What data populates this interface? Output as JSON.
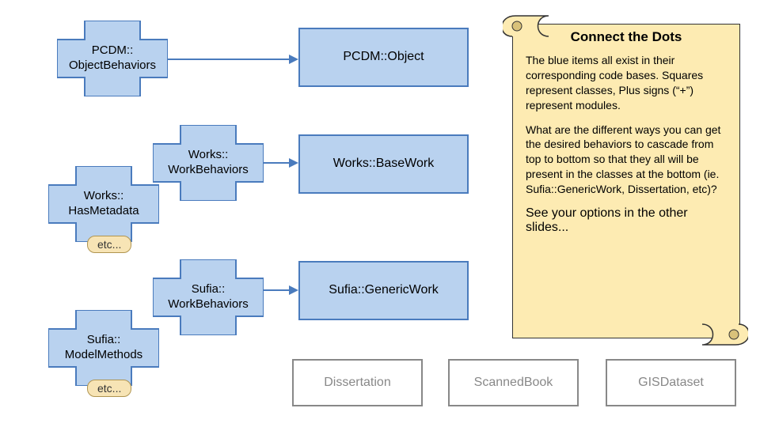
{
  "plus_shapes": {
    "pcdm_obj_beh": "PCDM::\nObjectBehaviors",
    "works_work_beh": "Works::\nWorkBehaviors",
    "works_has_meta": "Works::\nHasMetadata",
    "sufia_work_beh": "Sufia::\nWorkBehaviors",
    "sufia_model_meth": "Sufia::\nModelMethods"
  },
  "rects_blue": {
    "pcdm_object": "PCDM::Object",
    "works_basework": "Works::BaseWork",
    "sufia_genericwork": "Sufia::GenericWork"
  },
  "rects_white": {
    "dissertation": "Dissertation",
    "scannedbook": "ScannedBook",
    "gisdataset": "GISDataset"
  },
  "etc_labels": {
    "etc1": "etc...",
    "etc2": "etc..."
  },
  "scroll": {
    "title": "Connect the Dots",
    "p1": "The blue items all exist in their corresponding code bases.  Squares represent classes, Plus signs (“+”) represent modules.",
    "p2": "What are the different ways you can get the desired behaviors to cascade from top to bottom so that they all will be present in the classes at the bottom (ie. Sufia::GenericWork, Dissertation, etc)?",
    "cta": "See your options in the other slides..."
  },
  "colors": {
    "blue_fill": "#b9d2ef",
    "blue_stroke": "#4a7bbd",
    "parchment": "#fdebb2"
  }
}
